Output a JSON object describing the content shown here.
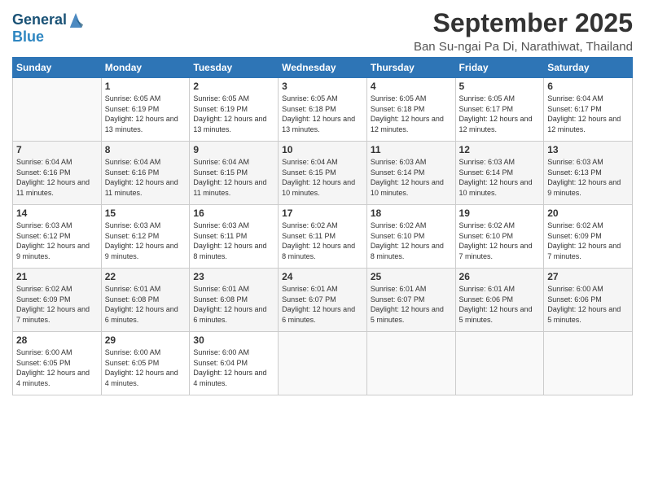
{
  "logo": {
    "line1": "General",
    "line2": "Blue"
  },
  "title": "September 2025",
  "subtitle": "Ban Su-ngai Pa Di, Narathiwat, Thailand",
  "weekdays": [
    "Sunday",
    "Monday",
    "Tuesday",
    "Wednesday",
    "Thursday",
    "Friday",
    "Saturday"
  ],
  "weeks": [
    [
      {
        "day": "",
        "sunrise": "",
        "sunset": "",
        "daylight": ""
      },
      {
        "day": "1",
        "sunrise": "Sunrise: 6:05 AM",
        "sunset": "Sunset: 6:19 PM",
        "daylight": "Daylight: 12 hours and 13 minutes."
      },
      {
        "day": "2",
        "sunrise": "Sunrise: 6:05 AM",
        "sunset": "Sunset: 6:19 PM",
        "daylight": "Daylight: 12 hours and 13 minutes."
      },
      {
        "day": "3",
        "sunrise": "Sunrise: 6:05 AM",
        "sunset": "Sunset: 6:18 PM",
        "daylight": "Daylight: 12 hours and 13 minutes."
      },
      {
        "day": "4",
        "sunrise": "Sunrise: 6:05 AM",
        "sunset": "Sunset: 6:18 PM",
        "daylight": "Daylight: 12 hours and 12 minutes."
      },
      {
        "day": "5",
        "sunrise": "Sunrise: 6:05 AM",
        "sunset": "Sunset: 6:17 PM",
        "daylight": "Daylight: 12 hours and 12 minutes."
      },
      {
        "day": "6",
        "sunrise": "Sunrise: 6:04 AM",
        "sunset": "Sunset: 6:17 PM",
        "daylight": "Daylight: 12 hours and 12 minutes."
      }
    ],
    [
      {
        "day": "7",
        "sunrise": "Sunrise: 6:04 AM",
        "sunset": "Sunset: 6:16 PM",
        "daylight": "Daylight: 12 hours and 11 minutes."
      },
      {
        "day": "8",
        "sunrise": "Sunrise: 6:04 AM",
        "sunset": "Sunset: 6:16 PM",
        "daylight": "Daylight: 12 hours and 11 minutes."
      },
      {
        "day": "9",
        "sunrise": "Sunrise: 6:04 AM",
        "sunset": "Sunset: 6:15 PM",
        "daylight": "Daylight: 12 hours and 11 minutes."
      },
      {
        "day": "10",
        "sunrise": "Sunrise: 6:04 AM",
        "sunset": "Sunset: 6:15 PM",
        "daylight": "Daylight: 12 hours and 10 minutes."
      },
      {
        "day": "11",
        "sunrise": "Sunrise: 6:03 AM",
        "sunset": "Sunset: 6:14 PM",
        "daylight": "Daylight: 12 hours and 10 minutes."
      },
      {
        "day": "12",
        "sunrise": "Sunrise: 6:03 AM",
        "sunset": "Sunset: 6:14 PM",
        "daylight": "Daylight: 12 hours and 10 minutes."
      },
      {
        "day": "13",
        "sunrise": "Sunrise: 6:03 AM",
        "sunset": "Sunset: 6:13 PM",
        "daylight": "Daylight: 12 hours and 9 minutes."
      }
    ],
    [
      {
        "day": "14",
        "sunrise": "Sunrise: 6:03 AM",
        "sunset": "Sunset: 6:12 PM",
        "daylight": "Daylight: 12 hours and 9 minutes."
      },
      {
        "day": "15",
        "sunrise": "Sunrise: 6:03 AM",
        "sunset": "Sunset: 6:12 PM",
        "daylight": "Daylight: 12 hours and 9 minutes."
      },
      {
        "day": "16",
        "sunrise": "Sunrise: 6:03 AM",
        "sunset": "Sunset: 6:11 PM",
        "daylight": "Daylight: 12 hours and 8 minutes."
      },
      {
        "day": "17",
        "sunrise": "Sunrise: 6:02 AM",
        "sunset": "Sunset: 6:11 PM",
        "daylight": "Daylight: 12 hours and 8 minutes."
      },
      {
        "day": "18",
        "sunrise": "Sunrise: 6:02 AM",
        "sunset": "Sunset: 6:10 PM",
        "daylight": "Daylight: 12 hours and 8 minutes."
      },
      {
        "day": "19",
        "sunrise": "Sunrise: 6:02 AM",
        "sunset": "Sunset: 6:10 PM",
        "daylight": "Daylight: 12 hours and 7 minutes."
      },
      {
        "day": "20",
        "sunrise": "Sunrise: 6:02 AM",
        "sunset": "Sunset: 6:09 PM",
        "daylight": "Daylight: 12 hours and 7 minutes."
      }
    ],
    [
      {
        "day": "21",
        "sunrise": "Sunrise: 6:02 AM",
        "sunset": "Sunset: 6:09 PM",
        "daylight": "Daylight: 12 hours and 7 minutes."
      },
      {
        "day": "22",
        "sunrise": "Sunrise: 6:01 AM",
        "sunset": "Sunset: 6:08 PM",
        "daylight": "Daylight: 12 hours and 6 minutes."
      },
      {
        "day": "23",
        "sunrise": "Sunrise: 6:01 AM",
        "sunset": "Sunset: 6:08 PM",
        "daylight": "Daylight: 12 hours and 6 minutes."
      },
      {
        "day": "24",
        "sunrise": "Sunrise: 6:01 AM",
        "sunset": "Sunset: 6:07 PM",
        "daylight": "Daylight: 12 hours and 6 minutes."
      },
      {
        "day": "25",
        "sunrise": "Sunrise: 6:01 AM",
        "sunset": "Sunset: 6:07 PM",
        "daylight": "Daylight: 12 hours and 5 minutes."
      },
      {
        "day": "26",
        "sunrise": "Sunrise: 6:01 AM",
        "sunset": "Sunset: 6:06 PM",
        "daylight": "Daylight: 12 hours and 5 minutes."
      },
      {
        "day": "27",
        "sunrise": "Sunrise: 6:00 AM",
        "sunset": "Sunset: 6:06 PM",
        "daylight": "Daylight: 12 hours and 5 minutes."
      }
    ],
    [
      {
        "day": "28",
        "sunrise": "Sunrise: 6:00 AM",
        "sunset": "Sunset: 6:05 PM",
        "daylight": "Daylight: 12 hours and 4 minutes."
      },
      {
        "day": "29",
        "sunrise": "Sunrise: 6:00 AM",
        "sunset": "Sunset: 6:05 PM",
        "daylight": "Daylight: 12 hours and 4 minutes."
      },
      {
        "day": "30",
        "sunrise": "Sunrise: 6:00 AM",
        "sunset": "Sunset: 6:04 PM",
        "daylight": "Daylight: 12 hours and 4 minutes."
      },
      {
        "day": "",
        "sunrise": "",
        "sunset": "",
        "daylight": ""
      },
      {
        "day": "",
        "sunrise": "",
        "sunset": "",
        "daylight": ""
      },
      {
        "day": "",
        "sunrise": "",
        "sunset": "",
        "daylight": ""
      },
      {
        "day": "",
        "sunrise": "",
        "sunset": "",
        "daylight": ""
      }
    ]
  ]
}
